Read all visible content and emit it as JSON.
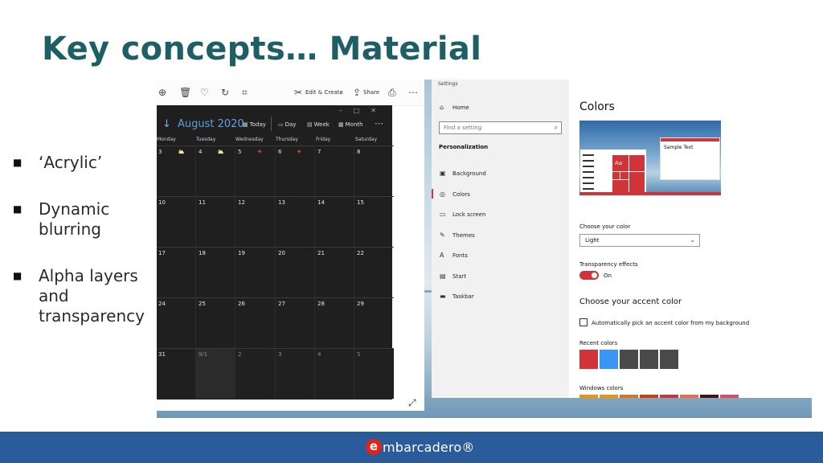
{
  "slide": {
    "title": "Key concepts… Material",
    "bullets": [
      "‘Acrylic’",
      "Dynamic blurring",
      "Alpha layers and transparency"
    ]
  },
  "photos_window": {
    "toolbar": {
      "edit_create": "Edit & Create",
      "share": "Share"
    }
  },
  "calendar": {
    "month": "August 2020",
    "views": [
      "Today",
      "Day",
      "Week",
      "Month"
    ],
    "weekdays": [
      "Monday",
      "Tuesday",
      "Wednesday",
      "Thursday",
      "Friday",
      "Saturday"
    ],
    "weeks": [
      [
        "3",
        "4",
        "5",
        "6",
        "7",
        "8"
      ],
      [
        "10",
        "11",
        "12",
        "13",
        "14",
        "15"
      ],
      [
        "17",
        "18",
        "19",
        "20",
        "21",
        "22"
      ],
      [
        "24",
        "25",
        "26",
        "27",
        "28",
        "29"
      ],
      [
        "31",
        "9/1",
        "2",
        "3",
        "4",
        "5"
      ]
    ]
  },
  "settings": {
    "app_title": "Settings",
    "home": "Home",
    "search_placeholder": "Find a setting",
    "section": "Personalization",
    "nav": [
      "Background",
      "Colors",
      "Lock screen",
      "Themes",
      "Fonts",
      "Start",
      "Taskbar"
    ],
    "active_nav": "Colors",
    "page_title": "Colors",
    "preview_sample_text": "Sample Text",
    "preview_tile_text": "Aa",
    "choose_color_label": "Choose your color",
    "choose_color_value": "Light",
    "transparency_label": "Transparency effects",
    "transparency_state": "On",
    "accent_heading": "Choose your accent color",
    "auto_accent_label": "Automatically pick an accent color from my background",
    "recent_colors_label": "Recent colors",
    "recent_colors": [
      "#d13438",
      "#3a96f3",
      "#4a4a4a",
      "#4a4a4a",
      "#4a4a4a"
    ],
    "windows_colors_label": "Windows colors",
    "windows_colors": [
      "#f29200",
      "#f29200",
      "#e3701b",
      "#da3b01",
      "#d13438",
      "#ef6950",
      "#4a1010",
      "#e74856"
    ]
  },
  "footer": {
    "logo_letter": "e",
    "logo_text": "mbarcadero®",
    "accent": "#e2231a",
    "bar_color": "#2a5b9b"
  }
}
